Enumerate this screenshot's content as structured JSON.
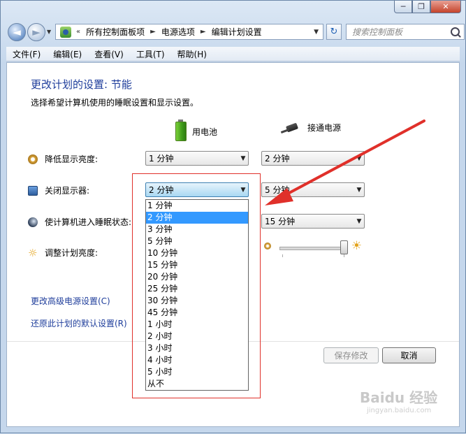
{
  "window": {
    "caption_buttons": [
      "─",
      "❐",
      "✕"
    ]
  },
  "nav": {
    "back_icon": "◄",
    "forward_icon": "►",
    "breadcrumb_prefix": "«",
    "breadcrumb": [
      "所有控制面板项",
      "电源选项",
      "编辑计划设置"
    ],
    "breadcrumb_sep": "►",
    "search_placeholder": "搜索控制面板"
  },
  "menu": [
    "文件(F)",
    "编辑(E)",
    "查看(V)",
    "工具(T)",
    "帮助(H)"
  ],
  "page": {
    "title": "更改计划的设置: 节能",
    "subtitle": "选择希望计算机使用的睡眠设置和显示设置。",
    "col_battery": "用电池",
    "col_plugged": "接通电源"
  },
  "rows": [
    {
      "label": "降低显示亮度:",
      "battery": "1 分钟",
      "plugged": "2 分钟"
    },
    {
      "label": "关闭显示器:",
      "battery": "2 分钟",
      "plugged": "5 分钟"
    },
    {
      "label": "使计算机进入睡眠状态:",
      "battery": "",
      "plugged": "15 分钟"
    },
    {
      "label": "调整计划亮度:"
    }
  ],
  "dropdown_options": [
    "1 分钟",
    "2 分钟",
    "3 分钟",
    "5 分钟",
    "10 分钟",
    "15 分钟",
    "20 分钟",
    "25 分钟",
    "30 分钟",
    "45 分钟",
    "1 小时",
    "2 小时",
    "3 小时",
    "4 小时",
    "5 小时",
    "从不"
  ],
  "dropdown_selected_index": 1,
  "brightness_level": 0.95,
  "links": {
    "advanced": "更改高级电源设置(C)",
    "restore": "还原此计划的默认设置(R)"
  },
  "buttons": {
    "save": "保存修改",
    "cancel": "取消"
  },
  "watermark": {
    "brand": "Baidu 经验",
    "url": "jingyan.baidu.com"
  },
  "colors": {
    "link": "#1e3d9b",
    "selection": "#3399ff",
    "annotation": "#e0302a"
  }
}
